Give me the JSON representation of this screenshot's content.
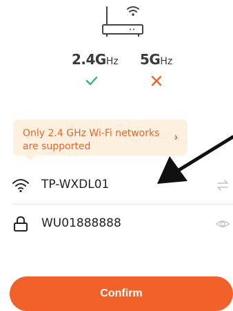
{
  "router_icon": "router-wifi-icon",
  "bands": [
    {
      "main": "2.4G",
      "unit": "Hz",
      "status_icon": "check-icon",
      "status_color": "#3cb371"
    },
    {
      "main": "5G",
      "unit": "Hz",
      "status_icon": "close-icon",
      "status_color": "#f0622a"
    }
  ],
  "tip": {
    "text": "Only 2.4 GHz Wi-Fi networks are supported",
    "arrow": "›"
  },
  "wifi": {
    "icon": "wifi-icon",
    "ssid": "TP-WXDL01",
    "action_icon": "switch-arrows-icon"
  },
  "password": {
    "icon": "lock-icon",
    "value": "WU01888888",
    "action_icon": "eye-icon"
  },
  "confirm_label": "Confirm",
  "colors": {
    "accent": "#f0622a",
    "tip_background": "#fdf0df",
    "success": "#3cb371"
  }
}
